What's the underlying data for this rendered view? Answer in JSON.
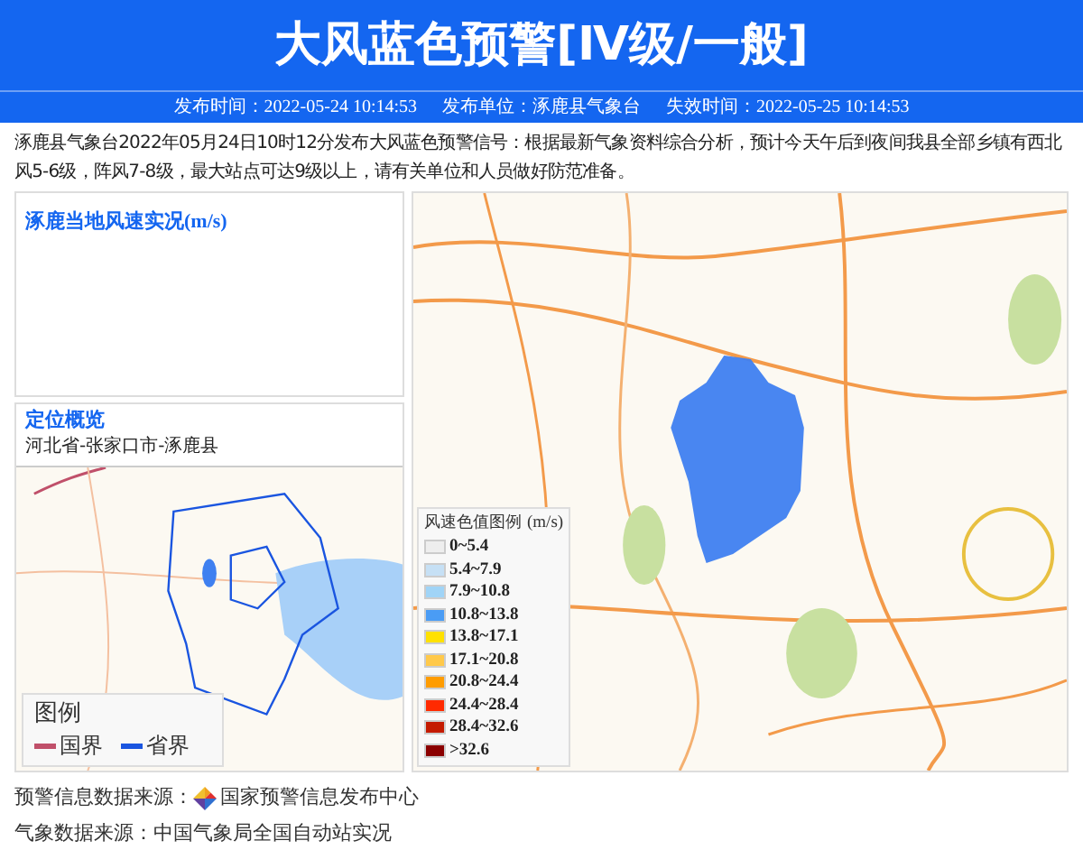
{
  "header": {
    "title": "大风蓝色预警[Ⅳ级/一般]"
  },
  "meta": [
    {
      "label": "发布时间：",
      "value": "2022-05-24 10:14:53"
    },
    {
      "label": "发布单位：",
      "value": "涿鹿县气象台"
    },
    {
      "label": "失效时间：",
      "value": "2022-05-25 10:14:53"
    }
  ],
  "description": "涿鹿县气象台2022年05月24日10时12分发布大风蓝色预警信号：根据最新气象资料综合分析，预计今天午后到夜间我县全部乡镇有西北风5-6级，阵风7-8级，最大站点可达9级以上，请有关单位和人员做好防范准备。",
  "wind_panel": {
    "title": "涿鹿当地风速实况(m/s)"
  },
  "location_panel": {
    "title": "定位概览",
    "path": "河北省-张家口市-涿鹿县",
    "legend": {
      "title": "图例",
      "items": [
        {
          "label": "国界",
          "color": "#c0506a"
        },
        {
          "label": "省界",
          "color": "#1a55e0"
        }
      ]
    }
  },
  "wind_legend": {
    "title": "风速色值图例",
    "unit": "(m/s)",
    "items": [
      {
        "label": "0~5.4",
        "color": "#eeeeee"
      },
      {
        "label": "5.4~7.9",
        "color": "#c6e0f5"
      },
      {
        "label": "7.9~10.8",
        "color": "#a0d4f7"
      },
      {
        "label": "10.8~13.8",
        "color": "#4a9cf5"
      },
      {
        "label": "13.8~17.1",
        "color": "#ffe100"
      },
      {
        "label": "17.1~20.8",
        "color": "#ffc94a"
      },
      {
        "label": "20.8~24.4",
        "color": "#ff9c00"
      },
      {
        "label": "24.4~28.4",
        "color": "#ff2a00"
      },
      {
        "label": "28.4~32.6",
        "color": "#c41a00"
      },
      {
        "label": ">32.6",
        "color": "#8b0000"
      }
    ]
  },
  "sources": [
    {
      "label": "预警信息数据来源：",
      "value": "国家预警信息发布中心",
      "logo": true
    },
    {
      "label": "气象数据来源：",
      "value": "中国气象局全国自动站实况",
      "logo": false
    }
  ]
}
